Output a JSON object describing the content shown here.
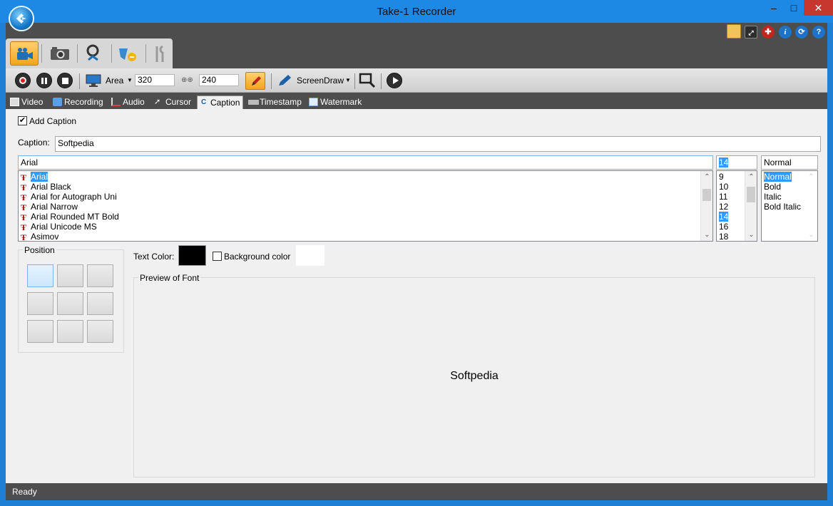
{
  "window": {
    "title": "Take-1 Recorder",
    "min": "–",
    "max": "□",
    "close": "✕"
  },
  "toolbar": {
    "area_label": "Area",
    "width": "320",
    "height": "240",
    "screendraw_label": "ScreenDraw"
  },
  "tabs": [
    {
      "label": "Video",
      "icon": "film-icon"
    },
    {
      "label": "Recording",
      "icon": "recording-icon"
    },
    {
      "label": "Audio",
      "icon": "audio-icon"
    },
    {
      "label": "Cursor",
      "icon": "cursor-icon"
    },
    {
      "label": "Caption",
      "icon": "caption-icon"
    },
    {
      "label": "Timestamp",
      "icon": "timestamp-icon"
    },
    {
      "label": "Watermark",
      "icon": "watermark-icon"
    }
  ],
  "caption": {
    "add_caption_label": "Add Caption",
    "add_caption_checked": true,
    "caption_label": "Caption:",
    "caption_value": "Softpedia",
    "font_value": "Arial",
    "size_value": "14",
    "style_value": "Normal",
    "fonts": [
      "Arial",
      "Arial Black",
      "Arial for Autograph Uni",
      "Arial Narrow",
      "Arial Rounded MT Bold",
      "Arial Unicode MS",
      "Asimov"
    ],
    "sizes": [
      "9",
      "10",
      "11",
      "12",
      "14",
      "16",
      "18"
    ],
    "styles": [
      "Normal",
      "Bold",
      "Italic",
      "Bold Italic"
    ],
    "position_label": "Position",
    "text_color_label": "Text Color:",
    "text_color": "#000000",
    "bg_color_label": "Background color",
    "bg_color": "#ffffff",
    "preview_label": "Preview of Font",
    "preview_text": "Softpedia"
  },
  "status": {
    "text": "Ready"
  },
  "colors": {
    "accent": "#1e88e5",
    "dark": "#4d4d4d",
    "selection": "#3399ff",
    "close": "#c7372f"
  }
}
